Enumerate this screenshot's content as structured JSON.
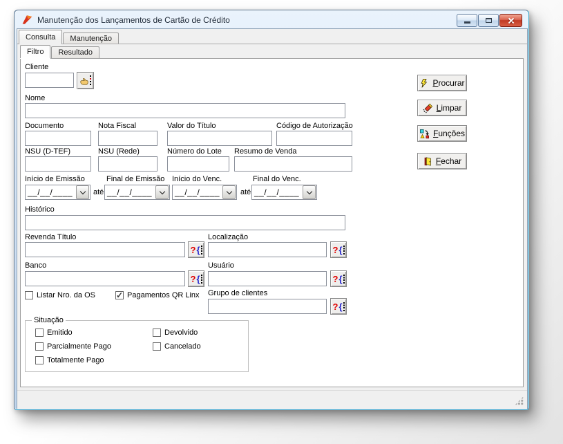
{
  "window": {
    "title": "Manutenção dos Lançamentos de Cartão de Crédito"
  },
  "outer_tabs": [
    {
      "label": "Consulta",
      "active": true
    },
    {
      "label": "Manutenção",
      "active": false
    }
  ],
  "inner_tabs": [
    {
      "label": "Filtro",
      "active": true
    },
    {
      "label": "Resultado",
      "active": false
    }
  ],
  "filter": {
    "cliente": {
      "label": "Cliente",
      "value": ""
    },
    "nome": {
      "label": "Nome",
      "value": ""
    },
    "documento": {
      "label": "Documento",
      "value": ""
    },
    "nota_fiscal": {
      "label": "Nota Fiscal",
      "value": ""
    },
    "valor_titulo": {
      "label": "Valor do Título",
      "value": ""
    },
    "codigo_autorizacao": {
      "label": "Código de Autorização",
      "value": ""
    },
    "nsu_dtef": {
      "label": "NSU (D-TEF)",
      "value": ""
    },
    "nsu_rede": {
      "label": "NSU (Rede)",
      "value": ""
    },
    "numero_lote": {
      "label": "Número do Lote",
      "value": ""
    },
    "resumo_venda": {
      "label": "Resumo de Venda",
      "value": ""
    },
    "inicio_emissao": {
      "label": "Início de Emissão",
      "value": "__/__/____"
    },
    "final_emissao": {
      "label": "Final de Emissão",
      "value": "__/__/____"
    },
    "inicio_venc": {
      "label": "Início do Venc.",
      "value": "__/__/____"
    },
    "final_venc": {
      "label": "Final do Venc.",
      "value": "__/__/____"
    },
    "ate": "até",
    "historico": {
      "label": "Histórico",
      "value": ""
    },
    "revenda_titulo": {
      "label": "Revenda Título",
      "value": ""
    },
    "localizacao": {
      "label": "Localização",
      "value": ""
    },
    "banco": {
      "label": "Banco",
      "value": ""
    },
    "usuario": {
      "label": "Usuário",
      "value": ""
    },
    "grupo_clientes": {
      "label": "Grupo de clientes",
      "value": ""
    },
    "listar_os": {
      "label": "Listar Nro. da OS",
      "checked": false
    },
    "qr_linx": {
      "label": "Pagamentos QR Linx",
      "checked": true
    },
    "situacao": {
      "legend": "Situação",
      "options": [
        {
          "label": "Emitido",
          "checked": false
        },
        {
          "label": "Parcialmente Pago",
          "checked": false
        },
        {
          "label": "Totalmente Pago",
          "checked": false
        },
        {
          "label": "Devolvido",
          "checked": false
        },
        {
          "label": "Cancelado",
          "checked": false
        }
      ]
    }
  },
  "actions": {
    "procurar": {
      "mnemonic": "P",
      "rest": "rocurar"
    },
    "limpar": {
      "mnemonic": "L",
      "rest": "impar"
    },
    "funcoes": {
      "mnemonic": "F",
      "rest": "unções"
    },
    "fechar": {
      "mnemonic": "F",
      "rest": "echar"
    }
  },
  "icons": {
    "lookup_q": "?",
    "lookup_brace": "{",
    "check": "✓"
  },
  "colors": {
    "titlebar_blue": "#d3e3f6",
    "close_button_red": "#c03a24",
    "lookup_question": "#e00000",
    "lookup_brace": "#2323cc",
    "icon_yellow": "#ffe83a"
  }
}
